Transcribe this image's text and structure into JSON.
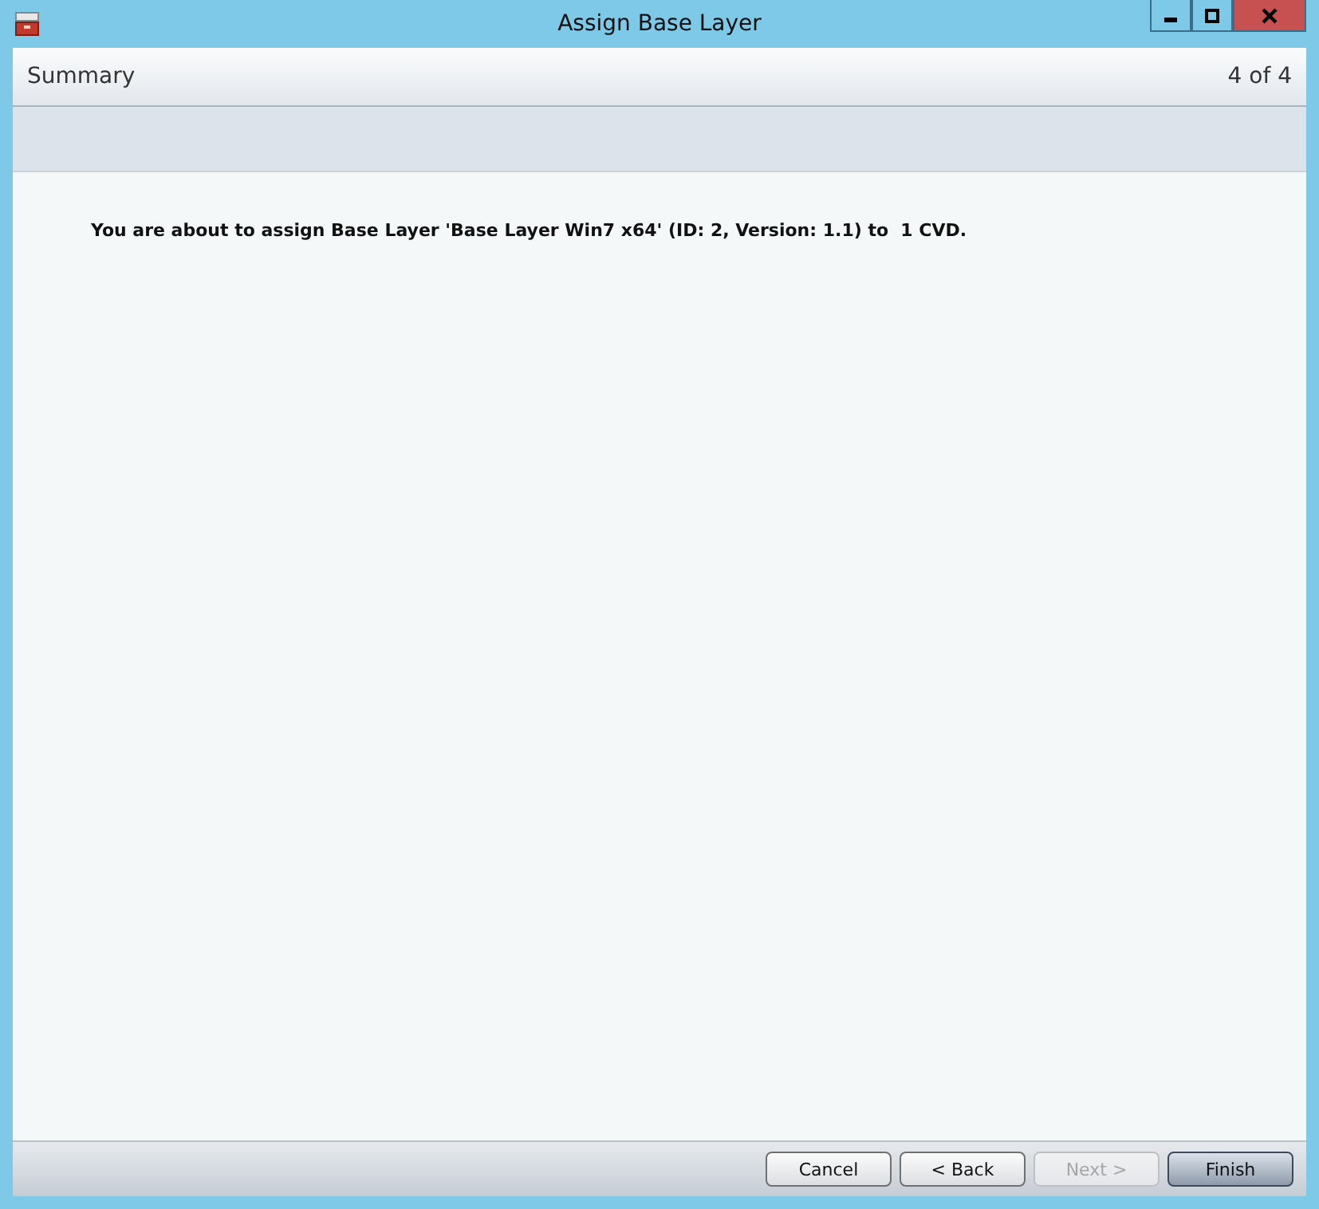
{
  "window": {
    "title": "Assign Base Layer"
  },
  "header": {
    "title": "Summary",
    "step": "4 of 4"
  },
  "message": "You are about to assign Base Layer 'Base Layer Win7 x64' (ID: 2, Version: 1.1) to  1 CVD.",
  "buttons": [
    {
      "label": "Cancel",
      "disabled": false,
      "default": false
    },
    {
      "label": "< Back",
      "disabled": false,
      "default": false
    },
    {
      "label": "Next >",
      "disabled": true,
      "default": false
    },
    {
      "label": "Finish",
      "disabled": false,
      "default": true
    }
  ]
}
